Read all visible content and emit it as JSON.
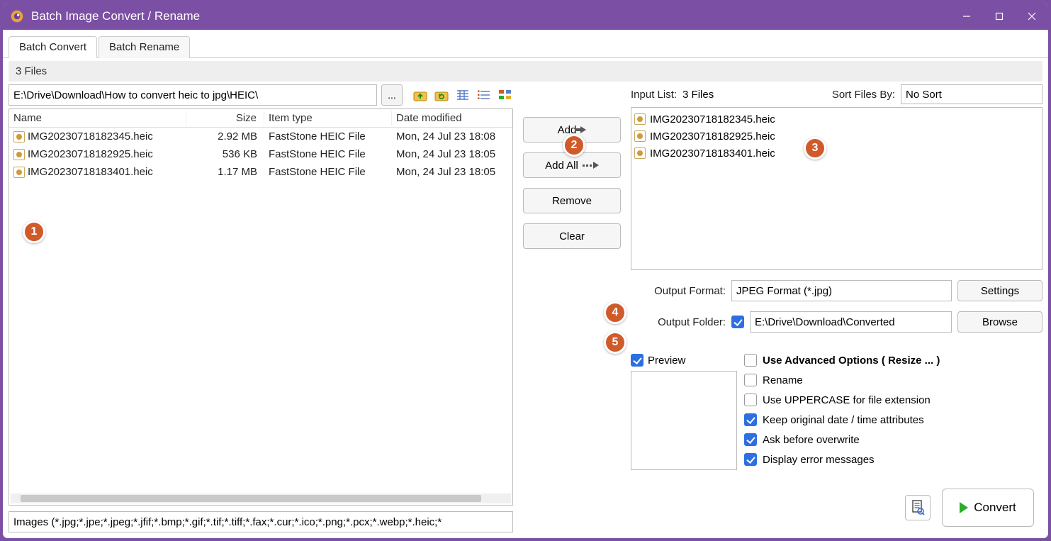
{
  "window": {
    "title": "Batch Image Convert / Rename"
  },
  "tabs": {
    "convert": "Batch Convert",
    "rename": "Batch Rename"
  },
  "filesbar": "3 Files",
  "path": "E:\\Drive\\Download\\How to convert heic to jpg\\HEIC\\",
  "dotdot": "...",
  "columns": {
    "name": "Name",
    "size": "Size",
    "type": "Item type",
    "date": "Date modified"
  },
  "files": [
    {
      "name": "IMG20230718182345.heic",
      "size": "2.92 MB",
      "type": "FastStone HEIC File",
      "date": "Mon, 24 Jul 23 18:08"
    },
    {
      "name": "IMG20230718182925.heic",
      "size": "536 KB",
      "type": "FastStone HEIC File",
      "date": "Mon, 24 Jul 23 18:05"
    },
    {
      "name": "IMG20230718183401.heic",
      "size": "1.17 MB",
      "type": "FastStone HEIC File",
      "date": "Mon, 24 Jul 23 18:05"
    }
  ],
  "filetype_filter": "Images (*.jpg;*.jpe;*.jpeg;*.jfif;*.bmp;*.gif;*.tif;*.tiff;*.fax;*.cur;*.ico;*.png;*.pcx;*.webp;*.heic;*",
  "buttons": {
    "add": "Add",
    "addall": "Add All",
    "remove": "Remove",
    "clear": "Clear",
    "settings": "Settings",
    "browse": "Browse",
    "convert": "Convert"
  },
  "inputlist": {
    "label": "Input List:",
    "count": "3 Files",
    "sortlabel": "Sort Files By:",
    "sortvalue": "No Sort",
    "items": [
      "IMG20230718182345.heic",
      "IMG20230718182925.heic",
      "IMG20230718183401.heic"
    ]
  },
  "output": {
    "format_label": "Output Format:",
    "format": "JPEG Format (*.jpg)",
    "folder_label": "Output Folder:",
    "folder_checked": true,
    "folder": "E:\\Drive\\Download\\Converted"
  },
  "preview": {
    "label": "Preview",
    "checked": true
  },
  "options": {
    "advanced": {
      "label": "Use Advanced Options ( Resize ... )",
      "checked": false
    },
    "rename": {
      "label": "Rename",
      "checked": false
    },
    "uppercase": {
      "label": "Use UPPERCASE for file extension",
      "checked": false
    },
    "keepdate": {
      "label": "Keep original date / time attributes",
      "checked": true
    },
    "askoverwrite": {
      "label": "Ask before overwrite",
      "checked": true
    },
    "errors": {
      "label": "Display error messages",
      "checked": true
    }
  },
  "badges": {
    "b1": "1",
    "b2": "2",
    "b3": "3",
    "b4": "4",
    "b5": "5"
  }
}
